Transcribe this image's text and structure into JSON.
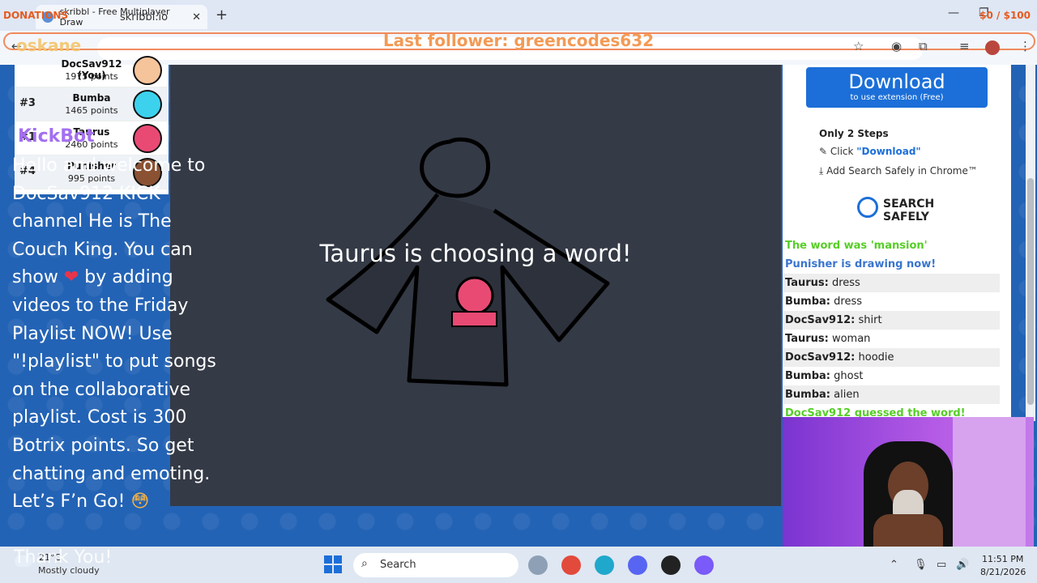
{
  "browser": {
    "tab_title": "skribbl - Free Multiplayer Draw",
    "url": "skribbl.io",
    "close_glyph": "✕",
    "new_tab_glyph": "+",
    "back_glyph": "←"
  },
  "stream_overlay": {
    "donations_label": "DONATIONS",
    "goal": "$0 / $100",
    "brand": "oskane",
    "last_follower": "Last follower: greencodes632",
    "kickbot": "KickBot",
    "message_lines": [
      "Hello and welcome to",
      "DocSav912 KICK",
      "channel He is The",
      "Couch King. You can",
      "show",
      "by adding",
      "videos to the Friday",
      "Playlist NOW! Use",
      "\"!playlist\" to put songs",
      "on the collaborative",
      "playlist. Cost is 300",
      "Botrix points. So get",
      "chatting and emoting.",
      "Let’s F’n Go!"
    ],
    "heart": "❤",
    "emoji": "😳",
    "thank_you": "Thank You!"
  },
  "players": [
    {
      "rank": "",
      "name": "DocSav912 (You)",
      "points": "1975 points",
      "color": "#f6c49a"
    },
    {
      "rank": "#3",
      "name": "Bumba",
      "points": "1465 points",
      "color": "#3cd2ee"
    },
    {
      "rank": "#1",
      "name": "Taurus",
      "points": "2460 points",
      "color": "#e94a74"
    },
    {
      "rank": "#4",
      "name": "Punisher",
      "points": "995 points",
      "color": "#8a5233"
    }
  ],
  "game": {
    "status": "Taurus is choosing a word!"
  },
  "ad": {
    "download_label": "Download",
    "download_sub": "to use extension (Free)",
    "steps_title": "Only 2 Steps",
    "step1_prefix": "Click",
    "step1_link": "\"Download\"",
    "step2": "Add Search Safely in Chrome™",
    "logo_line1": "SEARCH",
    "logo_line2": "SAFELY"
  },
  "chat": [
    {
      "type": "system-green",
      "text": "The word was 'mansion'"
    },
    {
      "type": "system-blue",
      "text": "Punisher is drawing now!"
    },
    {
      "type": "msg",
      "user": "Taurus:",
      "text": "dress"
    },
    {
      "type": "msg",
      "user": "Bumba:",
      "text": "dress"
    },
    {
      "type": "msg",
      "user": "DocSav912:",
      "text": "shirt"
    },
    {
      "type": "msg",
      "user": "Taurus:",
      "text": "woman"
    },
    {
      "type": "msg",
      "user": "DocSav912:",
      "text": "hoodie"
    },
    {
      "type": "msg",
      "user": "Bumba:",
      "text": "ghost"
    },
    {
      "type": "msg",
      "user": "Bumba:",
      "text": "alien"
    },
    {
      "type": "system-green",
      "text": "DocSav912 guessed the word!"
    }
  ],
  "taskbar": {
    "weather_temp": "21°C",
    "weather_desc": "Mostly cloudy",
    "search_placeholder": "Search",
    "time": "11:51 PM",
    "date": "8/21/2026"
  },
  "colors": {
    "accent_blue": "#1c6fd8",
    "guess_green": "#56ce27",
    "drawing_blue": "#3975ce",
    "canvas_bg": "#343a46"
  }
}
